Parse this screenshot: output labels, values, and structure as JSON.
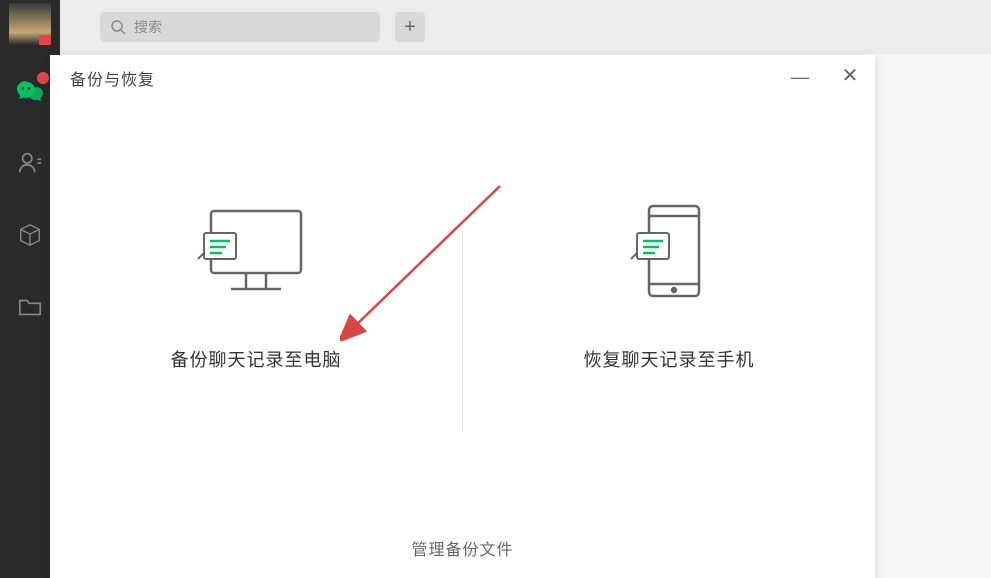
{
  "sidebar": {
    "icons": {
      "chat": "chat-bubble-icon",
      "contacts": "contacts-icon",
      "favorites": "cube-icon",
      "files": "folder-icon"
    }
  },
  "header": {
    "search_placeholder": "搜索",
    "add_label": "+"
  },
  "dialog": {
    "title": "备份与恢复",
    "minimize": "—",
    "close": "✕",
    "backup_option": "备份聊天记录至电脑",
    "restore_option": "恢复聊天记录至手机",
    "footer_link": "管理备份文件"
  }
}
